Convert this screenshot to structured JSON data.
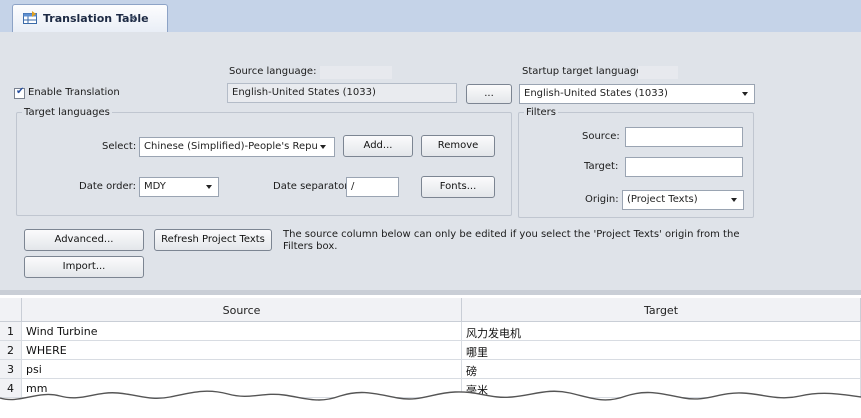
{
  "tab": {
    "title": "Translation Table",
    "close": "×",
    "icon": "translation-table-icon"
  },
  "form": {
    "enable_translation": {
      "label": "Enable Translation",
      "checked": true
    },
    "source_language": {
      "label": "Source language:",
      "value": "English-United States (1033)",
      "browse_label": "..."
    },
    "startup_target_language": {
      "label": "Startup target language:",
      "value": "English-United States (1033)"
    },
    "target_languages": {
      "group_label": "Target languages",
      "select_label": "Select:",
      "select_value": "Chinese (Simplified)-People's Repu",
      "add_label": "Add...",
      "remove_label": "Remove",
      "date_order_label": "Date order:",
      "date_order_value": "MDY",
      "date_separator_label": "Date separator:",
      "date_separator_value": "/",
      "fonts_label": "Fonts..."
    },
    "filters": {
      "group_label": "Filters",
      "source_label": "Source:",
      "source_value": "",
      "target_label": "Target:",
      "target_value": "",
      "origin_label": "Origin:",
      "origin_value": "(Project Texts)"
    },
    "advanced_label": "Advanced...",
    "refresh_label": "Refresh Project Texts",
    "import_label": "Import...",
    "note": "The source column below can only be edited if you select the 'Project Texts' origin from the Filters box."
  },
  "table": {
    "columns": [
      "Source",
      "Target"
    ],
    "rows": [
      {
        "num": "1",
        "source": "Wind Turbine",
        "target": "风力发电机"
      },
      {
        "num": "2",
        "source": " WHERE",
        "target": " 哪里"
      },
      {
        "num": "3",
        "source": "psi",
        "target": "磅"
      },
      {
        "num": "4",
        "source": "mm",
        "target": "毫米"
      }
    ]
  },
  "colors": {
    "panel": "#dfe3e9",
    "tabstrip": "#c5d3e8",
    "accent": "#2850a0"
  }
}
